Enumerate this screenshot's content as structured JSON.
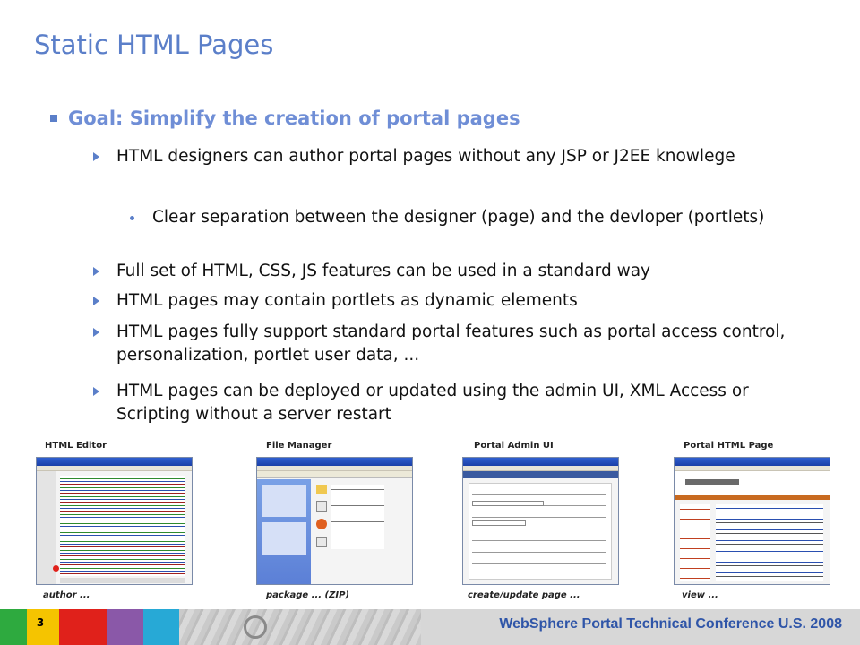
{
  "slide": {
    "title": "Static HTML Pages",
    "goal": "Goal: Simplify the creation of portal pages",
    "bullets": [
      "HTML designers can author portal pages without any JSP or J2EE knowlege",
      "Full set of HTML, CSS, JS features can be used in a standard way",
      "HTML pages may contain portlets as dynamic elements",
      "HTML pages fully support standard portal features such as portal access control, personalization, portlet user data, ...",
      "HTML pages can be deployed or updated using the admin UI, XML Access or Scripting without a server restart"
    ],
    "sub_bullet": "Clear separation between the designer (page) and the devloper (portlets)"
  },
  "screenshots": [
    {
      "label": "HTML Editor",
      "caption": "author ..."
    },
    {
      "label": "File Manager",
      "caption": "package ... (ZIP)"
    },
    {
      "label": "Portal Admin UI",
      "caption": "create/update page ..."
    },
    {
      "label": "Portal HTML Page",
      "caption": "view ..."
    }
  ],
  "footer": {
    "page_number": "3",
    "conference": "WebSphere Portal Technical Conference U.S. 2008"
  },
  "colors": {
    "accent": "#5b7fc9",
    "footer_text": "#2f55a8",
    "footer_blocks": [
      "#2eaa3f",
      "#f5c400",
      "#e0211b",
      "#8a58a8",
      "#27a9d6"
    ]
  }
}
